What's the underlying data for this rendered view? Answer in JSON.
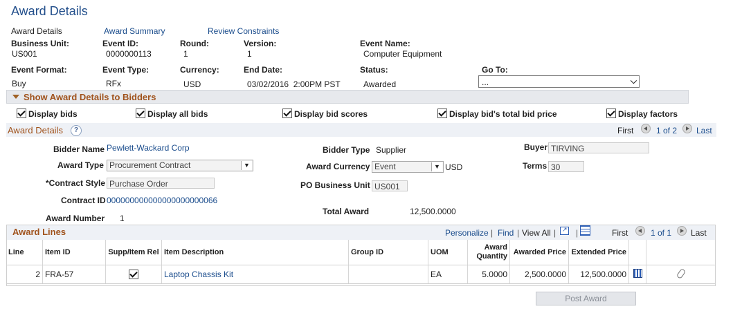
{
  "page": {
    "title": "Award Details"
  },
  "nav": {
    "current": "Award Details",
    "award_summary": "Award Summary",
    "review_constraints": "Review Constraints"
  },
  "header": {
    "business_unit_label": "Business Unit:",
    "business_unit": "US001",
    "event_id_label": "Event ID:",
    "event_id": "0000000113",
    "round_label": "Round:",
    "round": "1",
    "version_label": "Version:",
    "version": "1",
    "event_name_label": "Event Name:",
    "event_name": "Computer Equipment",
    "event_format_label": "Event Format:",
    "event_format": "Buy",
    "event_type_label": "Event Type:",
    "event_type": "RFx",
    "currency_label": "Currency:",
    "currency": "USD",
    "end_date_label": "End Date:",
    "end_date": "03/02/2016  2:00PM PST",
    "status_label": "Status:",
    "status": "Awarded",
    "goto_label": "Go To:",
    "goto_value": "..."
  },
  "show_section": {
    "label": "Show Award Details to Bidders"
  },
  "checkboxes": {
    "display_bids": "Display bids",
    "display_all_bids": "Display all bids",
    "display_bid_scores": "Display bid scores",
    "display_total_bid_price": "Display bid's total bid price",
    "display_factors": "Display factors"
  },
  "award_details": {
    "section_title": "Award Details",
    "nav_first": "First",
    "nav_count": "1 of 2",
    "nav_last": "Last",
    "bidder_name_label": "Bidder Name",
    "bidder_name": "Pewlett-Wackard Corp",
    "bidder_type_label": "Bidder Type",
    "bidder_type": "Supplier",
    "buyer_label": "Buyer",
    "buyer": "TIRVING",
    "award_type_label": "Award Type",
    "award_type": "Procurement Contract",
    "award_currency_label": "Award Currency",
    "award_currency": "Event",
    "award_currency_code": "USD",
    "terms_label": "Terms",
    "terms": "30",
    "contract_style_label": "*Contract Style",
    "contract_style": "Purchase Order",
    "po_bu_label": "PO Business Unit",
    "po_bu": "US001",
    "contract_id_label": "Contract ID",
    "contract_id": "000000000000000000000066",
    "total_award_label": "Total Award",
    "total_award": "12,500.0000",
    "award_number_label": "Award Number",
    "award_number": "1"
  },
  "award_lines": {
    "title": "Award Lines",
    "personalize": "Personalize",
    "find": "Find",
    "view_all": "View All",
    "nav_first": "First",
    "nav_count": "1 of 1",
    "nav_last": "Last",
    "columns": {
      "line": "Line",
      "item_id": "Item ID",
      "supp_item_rel": "Supp/Item Rel",
      "item_description": "Item Description",
      "group_id": "Group ID",
      "uom": "UOM",
      "award_quantity": "Award Quantity",
      "awarded_price": "Awarded Price",
      "extended_price": "Extended Price"
    },
    "rows": [
      {
        "line": "2",
        "item_id": "FRA-57",
        "item_description": "Laptop Chassis Kit",
        "group_id": "",
        "uom": "EA",
        "award_quantity": "5.0000",
        "awarded_price": "2,500.0000",
        "extended_price": "12,500.0000"
      }
    ]
  },
  "buttons": {
    "post_award": "Post Award"
  }
}
